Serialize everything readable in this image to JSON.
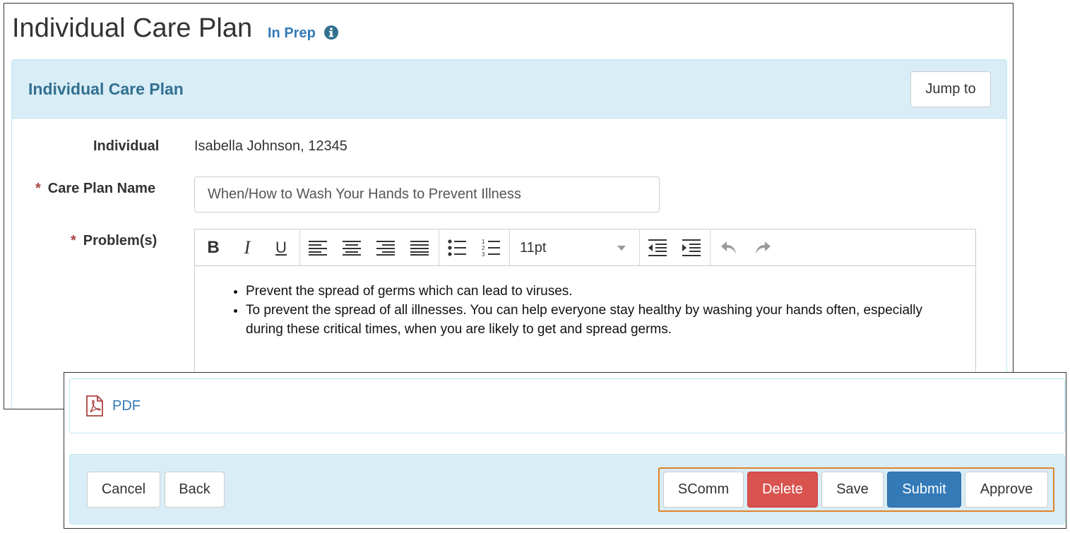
{
  "page": {
    "title": "Individual Care Plan",
    "status": "In Prep",
    "status_icon": "info-circle-icon"
  },
  "panel": {
    "title": "Individual Care Plan",
    "jump_to_label": "Jump to"
  },
  "form": {
    "individual_label": "Individual",
    "individual_value": "Isabella Johnson, 12345",
    "care_plan_name_label": "Care Plan Name",
    "care_plan_name_value": "When/How to Wash Your Hands to Prevent Illness",
    "problems_label": "Problem(s)",
    "required_marker": "*"
  },
  "editor": {
    "toolbar": {
      "buttons": [
        "bold-icon",
        "italic-icon",
        "underline-icon",
        "align-left-icon",
        "align-center-icon",
        "align-right-icon",
        "justify-icon",
        "bullet-list-icon",
        "numbered-list-icon",
        "outdent-icon",
        "indent-icon",
        "undo-icon",
        "redo-icon"
      ],
      "font_size": "11pt"
    },
    "bullets": [
      "Prevent the spread of germs which can lead to viruses.",
      "To prevent the spread of all illnesses. You can help everyone stay healthy by washing your hands often, especially during these critical times, when you are likely to get and spread germs."
    ]
  },
  "attachments": {
    "pdf_label": "PDF",
    "pdf_icon": "pdf-file-icon"
  },
  "footer": {
    "cancel_label": "Cancel",
    "back_label": "Back",
    "scomm_label": "SComm",
    "delete_label": "Delete",
    "save_label": "Save",
    "submit_label": "Submit",
    "approve_label": "Approve"
  },
  "colors": {
    "panel_heading_bg": "#d9edf7",
    "panel_title": "#31708f",
    "link": "#337ab7",
    "danger": "#d9534f",
    "primary": "#337ab7",
    "highlight_border": "#e0842a",
    "required": "#a94442"
  }
}
